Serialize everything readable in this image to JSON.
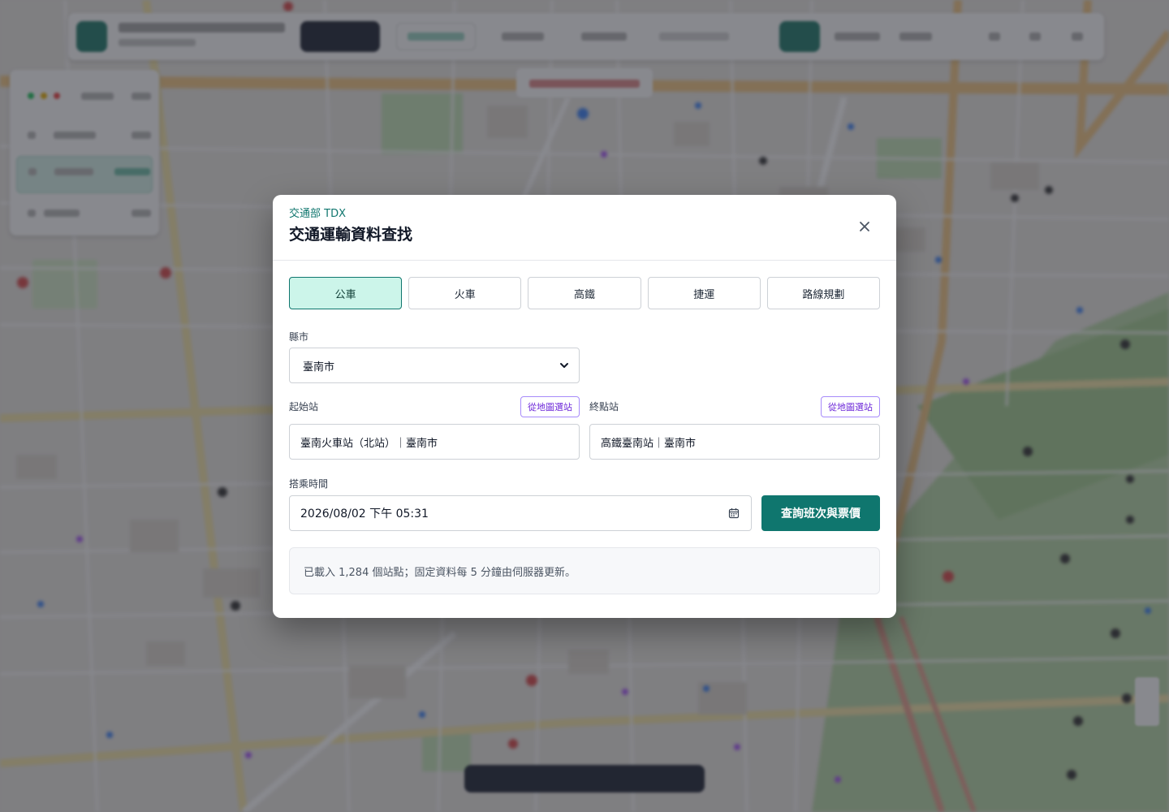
{
  "modal": {
    "eyebrow": "交通部 TDX",
    "title": "交通運輸資料查找",
    "close_icon": "close-icon",
    "tabs": [
      {
        "label": "公車",
        "active": true
      },
      {
        "label": "火車",
        "active": false
      },
      {
        "label": "高鐵",
        "active": false
      },
      {
        "label": "捷運",
        "active": false
      },
      {
        "label": "路線規劃",
        "active": false
      }
    ],
    "county": {
      "label": "縣市",
      "value": "臺南市"
    },
    "origin": {
      "label": "起始站",
      "pick_label": "從地圖選站",
      "value": "臺南火車站（北站）｜臺南市"
    },
    "destination": {
      "label": "終點站",
      "pick_label": "從地圖選站",
      "value": "高鐵臺南站｜臺南市"
    },
    "ride_time": {
      "label": "搭乘時間",
      "value": "2026/08/02 下午 05:31",
      "icon": "calendar-icon"
    },
    "submit_label": "查詢班次與票價",
    "info_text": "已載入 1,284 個站點；固定資料每 5 分鐘由伺服器更新。"
  },
  "colors": {
    "accent": "#0f766e",
    "tab_active_bg": "#ccf5ea",
    "map_pick": "#6d28d9",
    "overlay": "rgba(38,40,50,0.55)"
  }
}
